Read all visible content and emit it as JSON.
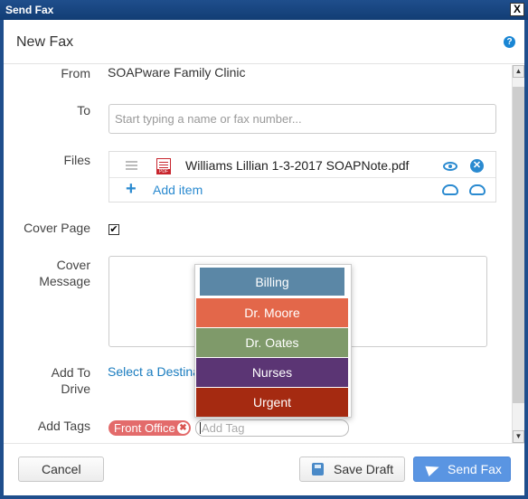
{
  "window": {
    "title": "Send Fax",
    "close_label": "X"
  },
  "dialog": {
    "title": "New Fax",
    "help_label": "?"
  },
  "form": {
    "from": {
      "label": "From",
      "value": "SOAPware Family Clinic"
    },
    "to": {
      "label": "To",
      "placeholder": "Start typing a name or fax number..."
    },
    "files": {
      "label": "Files",
      "items": [
        {
          "name": "Williams Lillian 1-3-2017 SOAPNote.pdf"
        }
      ],
      "add_label": "Add item"
    },
    "cover_page": {
      "label": "Cover Page",
      "checked": true,
      "check_glyph": "✔"
    },
    "cover_message": {
      "label_line1": "Cover",
      "label_line2": "Message",
      "value": ""
    },
    "add_to_drive": {
      "label_line1": "Add To",
      "label_line2": "Drive",
      "link": "Select a Destina"
    },
    "add_tags": {
      "label": "Add Tags",
      "tags": [
        {
          "name": "Front Office",
          "color": "#e36b6b",
          "remove_glyph": "✖"
        }
      ],
      "placeholder": "Add Tag"
    }
  },
  "tag_dropdown": {
    "options": [
      {
        "name": "Billing",
        "color": "#5b87a6"
      },
      {
        "name": "Dr. Moore",
        "color": "#e3674a"
      },
      {
        "name": "Dr. Oates",
        "color": "#7f9a6a"
      },
      {
        "name": "Nurses",
        "color": "#5b3574"
      },
      {
        "name": "Urgent",
        "color": "#a52a11"
      }
    ]
  },
  "footer": {
    "cancel": "Cancel",
    "save_draft": "Save Draft",
    "send_fax": "Send Fax"
  },
  "scrollbar": {
    "up_glyph": "▲",
    "down_glyph": "▼"
  }
}
